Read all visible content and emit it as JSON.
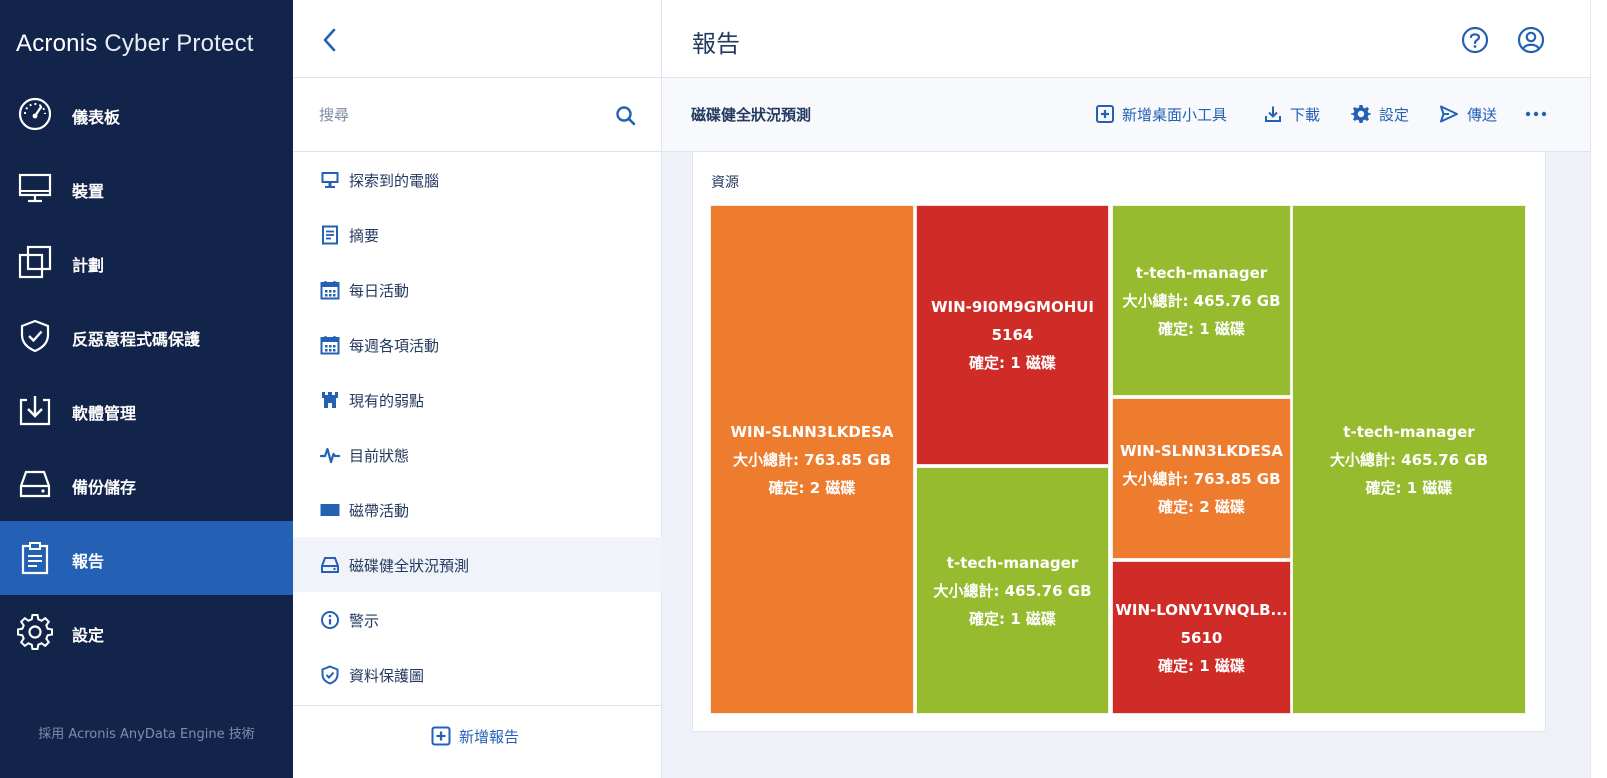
{
  "brand": {
    "name_part1": "Acronis",
    "name_part2": "Cyber Protect"
  },
  "nav": {
    "items": [
      {
        "label": "儀表板",
        "icon": "dashboard-icon"
      },
      {
        "label": "裝置",
        "icon": "monitor-icon"
      },
      {
        "label": "計劃",
        "icon": "plans-icon"
      },
      {
        "label": "反惡意程式碼保護",
        "icon": "shield-icon"
      },
      {
        "label": "軟體管理",
        "icon": "software-icon"
      },
      {
        "label": "備份儲存",
        "icon": "storage-icon"
      },
      {
        "label": "報告",
        "icon": "report-icon",
        "active": true
      },
      {
        "label": "設定",
        "icon": "gear-icon"
      }
    ],
    "powered_by": "採用 Acronis AnyData Engine 技術"
  },
  "reports_panel": {
    "search_placeholder": "搜尋",
    "items": [
      {
        "label": "探索到的電腦",
        "icon": "computer-icon"
      },
      {
        "label": "摘要",
        "icon": "document-icon"
      },
      {
        "label": "每日活動",
        "icon": "calendar-icon"
      },
      {
        "label": "每週各項活動",
        "icon": "calendar-icon"
      },
      {
        "label": "現有的弱點",
        "icon": "castle-icon"
      },
      {
        "label": "目前狀態",
        "icon": "pulse-icon"
      },
      {
        "label": "磁帶活動",
        "icon": "tape-icon"
      },
      {
        "label": "磁碟健全狀況預測",
        "icon": "disk-icon",
        "selected": true
      },
      {
        "label": "警示",
        "icon": "info-icon"
      },
      {
        "label": "資料保護圖",
        "icon": "shield-check-icon"
      }
    ],
    "add_report_label": "新增報告"
  },
  "main": {
    "title": "報告",
    "report_name": "磁碟健全狀況預測",
    "toolbar": {
      "add_widget": "新增桌面小工具",
      "download": "下載",
      "settings": "設定",
      "send": "傳送"
    },
    "widget": {
      "title": "資源",
      "tiles": [
        {
          "name": "WIN-SLNN3LKDESA",
          "line2": "大小總計: 763.85 GB",
          "line3": "確定: 2 磁碟",
          "status": "warning"
        },
        {
          "name": "WIN-9I0M9GMOHUI",
          "line2": "5164",
          "line3": "確定: 1 磁碟",
          "status": "critical"
        },
        {
          "name": "t-tech-manager",
          "line2": "大小總計: 465.76 GB",
          "line3": "確定: 1 磁碟",
          "status": "ok"
        },
        {
          "name": "t-tech-manager",
          "line2": "大小總計: 465.76 GB",
          "line3": "確定: 1 磁碟",
          "status": "ok"
        },
        {
          "name": "WIN-SLNN3LKDESA",
          "line2": "大小總計: 763.85 GB",
          "line3": "確定: 2 磁碟",
          "status": "warning"
        },
        {
          "name": "WIN-LONV1VNQLB...",
          "line2": "5610",
          "line3": "確定: 1 磁碟",
          "status": "critical"
        },
        {
          "name": "t-tech-manager",
          "line2": "大小總計: 465.76 GB",
          "line3": "確定: 1 磁碟",
          "status": "ok"
        }
      ]
    }
  },
  "colors": {
    "nav_bg": "#13244a",
    "nav_active": "#2461b5",
    "accent": "#2461b5",
    "status_ok": "#97bb2f",
    "status_warning": "#ee7c2f",
    "status_critical": "#cf2b27"
  }
}
